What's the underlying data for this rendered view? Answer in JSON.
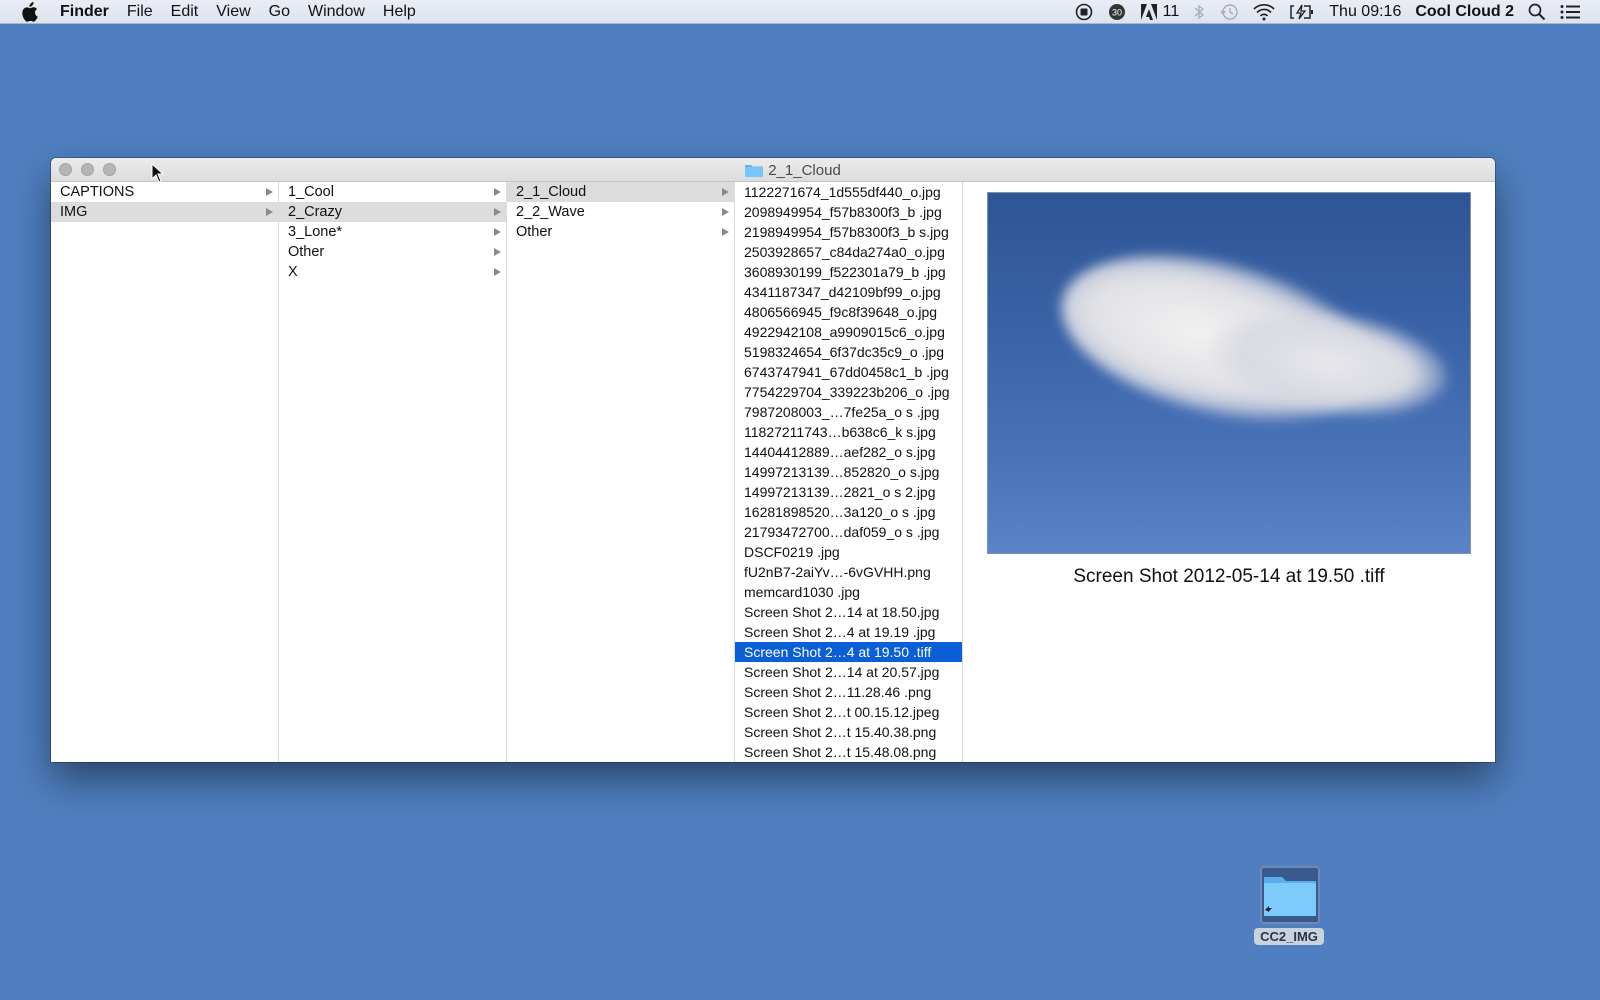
{
  "menubar": {
    "app_name": "Finder",
    "items": [
      "File",
      "Edit",
      "View",
      "Go",
      "Window",
      "Help"
    ],
    "status": {
      "adobe_count": "11",
      "clock": "Thu 09:16",
      "user": "Cool Cloud 2"
    }
  },
  "window": {
    "title": "2_1_Cloud",
    "columns": [
      {
        "items": [
          {
            "label": "CAPTIONS",
            "folder": true,
            "selected": false
          },
          {
            "label": "IMG",
            "folder": true,
            "selected": true
          }
        ]
      },
      {
        "items": [
          {
            "label": "1_Cool",
            "folder": true,
            "selected": false
          },
          {
            "label": "2_Crazy",
            "folder": true,
            "selected": true
          },
          {
            "label": "3_Lone*",
            "folder": true,
            "selected": false
          },
          {
            "label": "Other",
            "folder": true,
            "selected": false
          },
          {
            "label": "X",
            "folder": true,
            "selected": false
          }
        ]
      },
      {
        "items": [
          {
            "label": "2_1_Cloud",
            "folder": true,
            "selected": true
          },
          {
            "label": "2_2_Wave",
            "folder": true,
            "selected": false
          },
          {
            "label": "Other",
            "folder": true,
            "selected": false
          }
        ]
      },
      {
        "items": [
          {
            "label": "1122271674_1d555df440_o.jpg"
          },
          {
            "label": "2098949954_f57b8300f3_b .jpg"
          },
          {
            "label": "2198949954_f57b8300f3_b s.jpg"
          },
          {
            "label": "2503928657_c84da274a0_o.jpg"
          },
          {
            "label": "3608930199_f522301a79_b .jpg"
          },
          {
            "label": "4341187347_d42109bf99_o.jpg"
          },
          {
            "label": "4806566945_f9c8f39648_o.jpg"
          },
          {
            "label": "4922942108_a9909015c6_o.jpg"
          },
          {
            "label": "5198324654_6f37dc35c9_o  .jpg"
          },
          {
            "label": "6743747941_67dd0458c1_b .jpg"
          },
          {
            "label": "7754229704_339223b206_o .jpg"
          },
          {
            "label": "7987208003_…7fe25a_o s .jpg"
          },
          {
            "label": "11827211743…b638c6_k s.jpg"
          },
          {
            "label": "14404412889…aef282_o s.jpg"
          },
          {
            "label": "14997213139…852820_o s.jpg"
          },
          {
            "label": "14997213139…2821_o s 2.jpg"
          },
          {
            "label": "16281898520…3a120_o s .jpg"
          },
          {
            "label": "21793472700…daf059_o s .jpg"
          },
          {
            "label": "DSCF0219 .jpg"
          },
          {
            "label": "fU2nB7-2aiYv…-6vGVHH.png"
          },
          {
            "label": "memcard1030 .jpg"
          },
          {
            "label": "Screen Shot 2…14 at 18.50.jpg"
          },
          {
            "label": "Screen Shot 2…4 at 19.19 .jpg"
          },
          {
            "label": "Screen Shot 2…4 at 19.50 .tiff",
            "selected": true
          },
          {
            "label": "Screen Shot 2…14 at 20.57.jpg"
          },
          {
            "label": "Screen Shot 2…11.28.46 .png"
          },
          {
            "label": "Screen Shot 2…t 00.15.12.jpeg"
          },
          {
            "label": "Screen Shot 2…t 15.40.38.png"
          },
          {
            "label": "Screen Shot 2…t 15.48.08.png"
          }
        ]
      }
    ],
    "preview": {
      "filename": "Screen Shot 2012-05-14 at 19.50 .tiff"
    }
  },
  "desktop": {
    "icons": [
      {
        "label": "CC2_IMG"
      }
    ]
  },
  "colors": {
    "desktop": "#4f7fc0",
    "selection_blue": "#0a5fd6",
    "selection_gray": "#dcdcdc"
  }
}
